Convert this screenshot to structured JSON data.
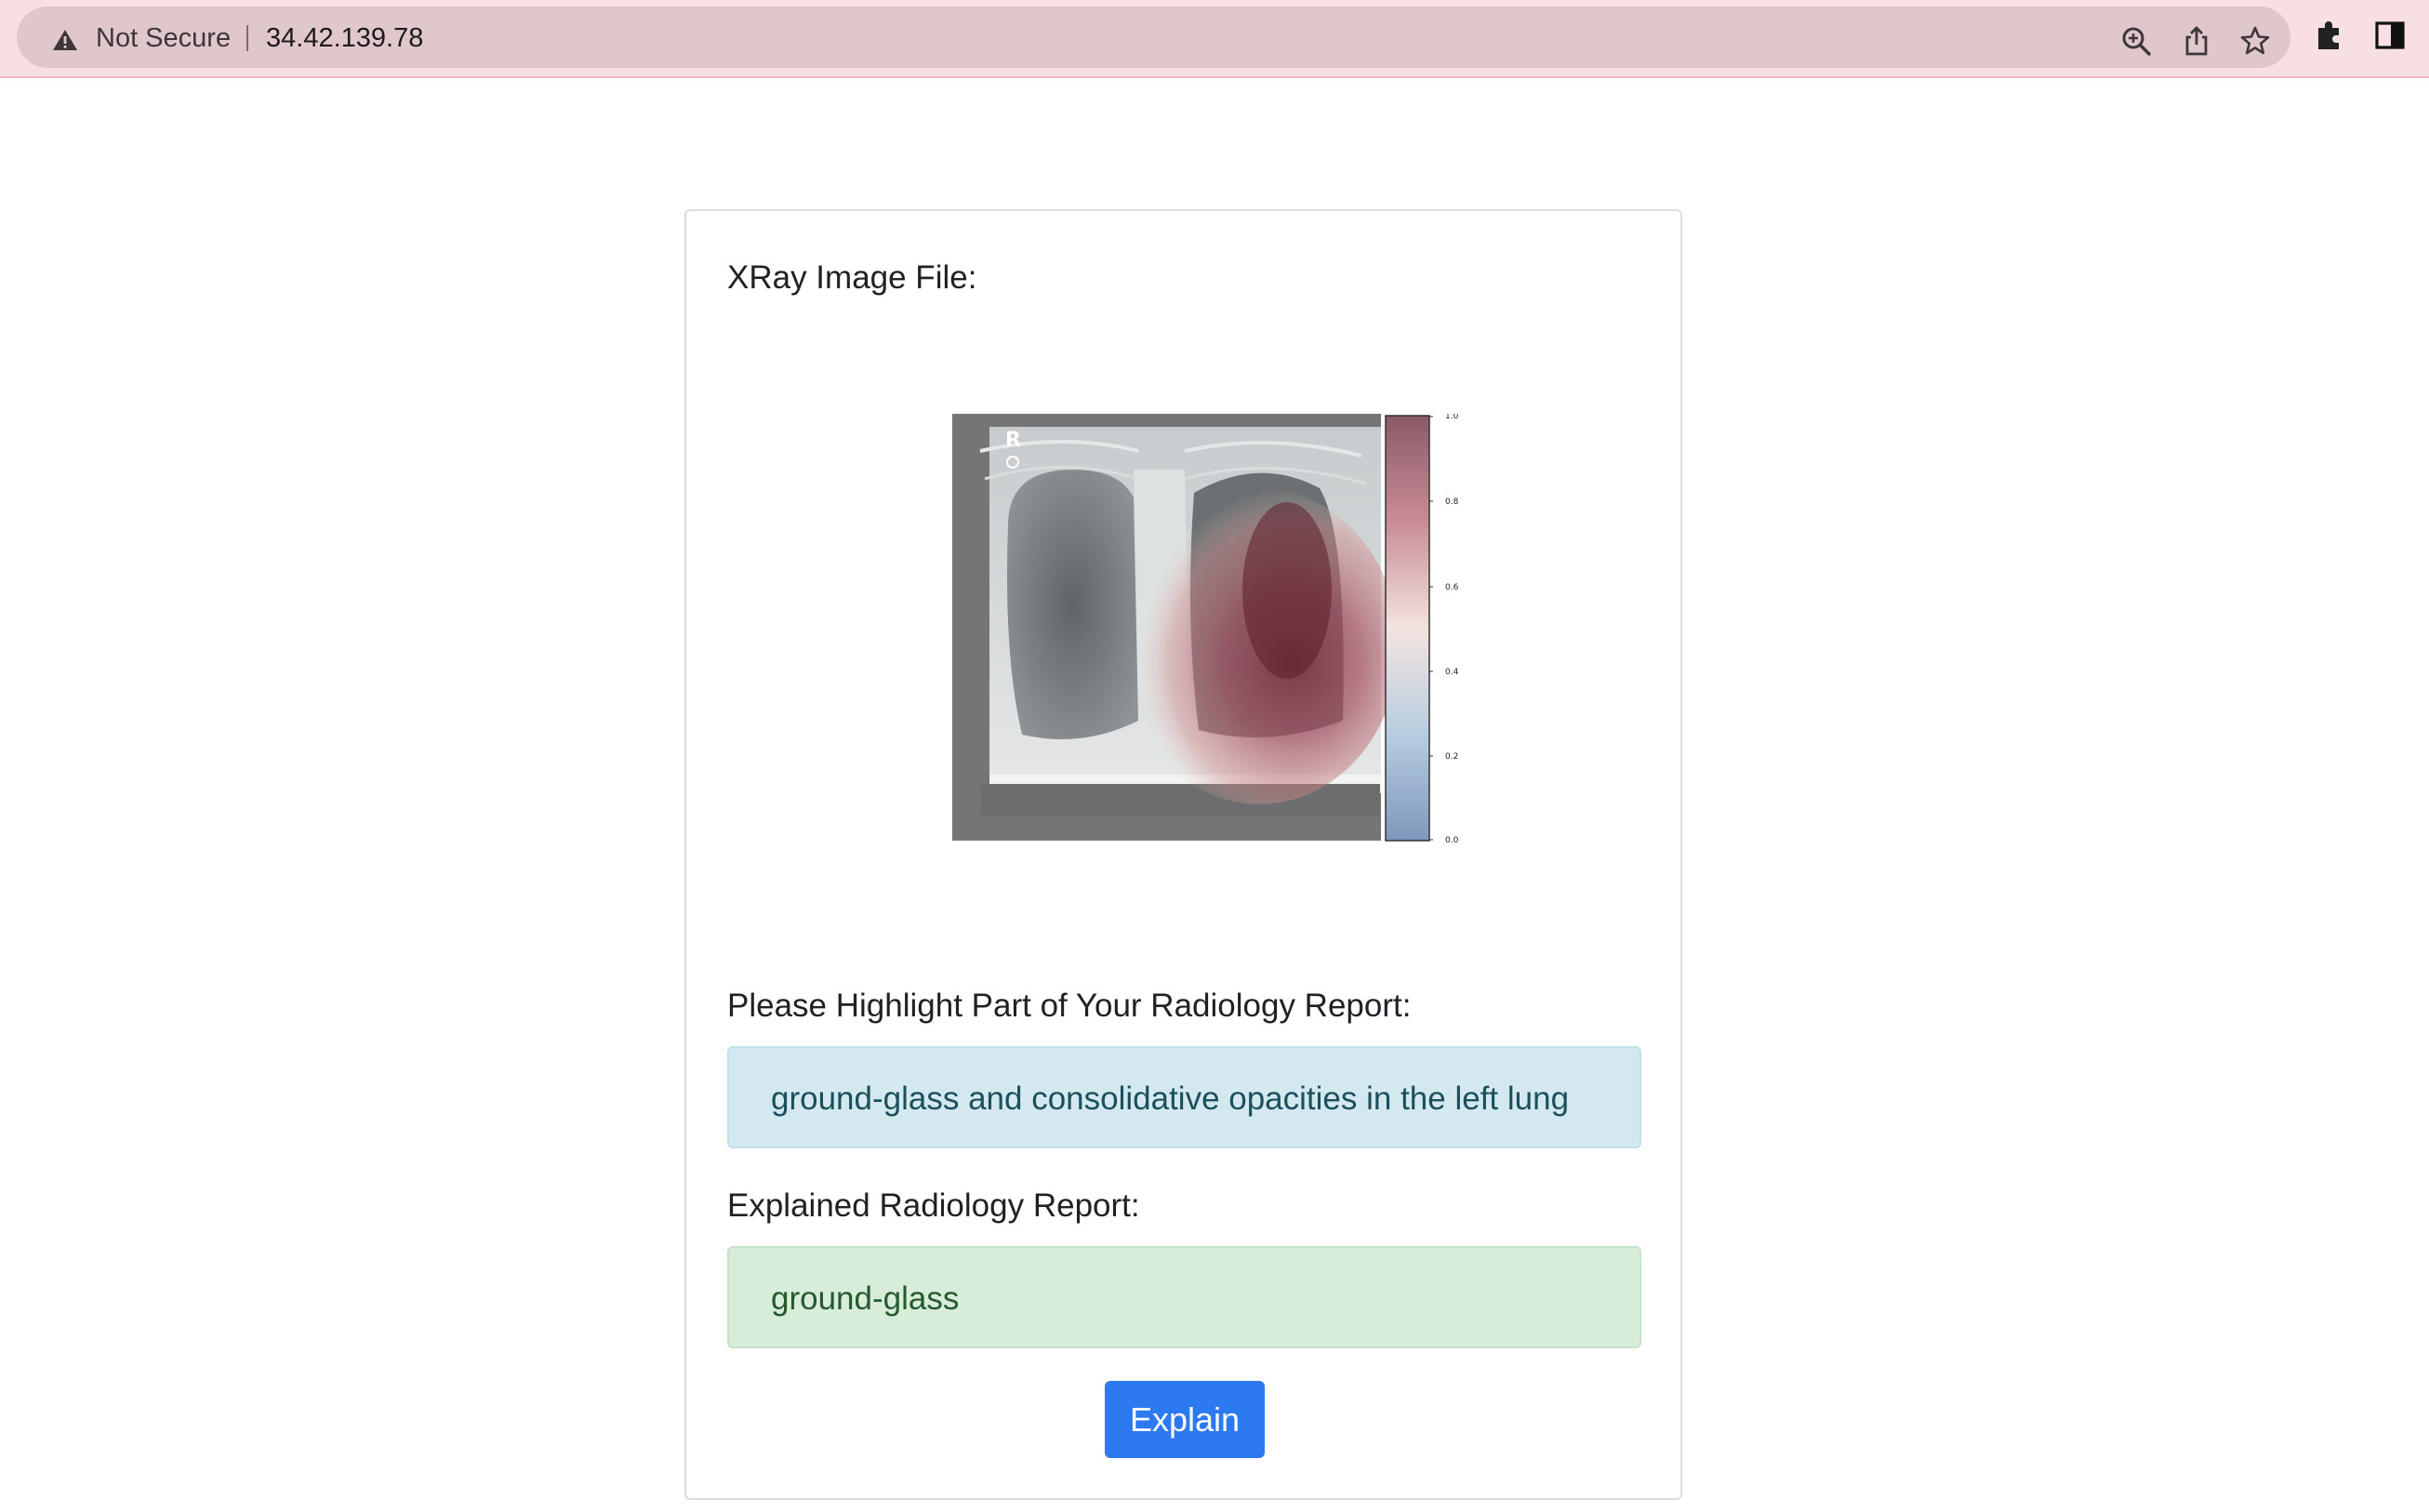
{
  "browser": {
    "security_text": "Not Secure",
    "url": "34.42.139.78",
    "icons": [
      "warning-icon",
      "zoom-icon",
      "share-icon",
      "bookmark-star-icon",
      "extensions-icon",
      "side-panel-icon"
    ]
  },
  "form": {
    "xray_label": "XRay Image File:",
    "highlight_label": "Please Highlight Part of Your Radiology Report:",
    "highlight_value": "ground-glass and consolidative opacities in the left lung",
    "explained_label": "Explained Radiology Report:",
    "explained_value": "ground-glass",
    "explain_button": "Explain"
  },
  "xray_figure": {
    "marker_letter": "R",
    "colorbar_ticks": [
      "1.0",
      "0.8",
      "0.6",
      "0.4",
      "0.2",
      "0.0"
    ],
    "colormap": [
      "#8b5a66",
      "#c98c97",
      "#f3e4e0",
      "#b8cde0",
      "#7d98bd"
    ]
  }
}
